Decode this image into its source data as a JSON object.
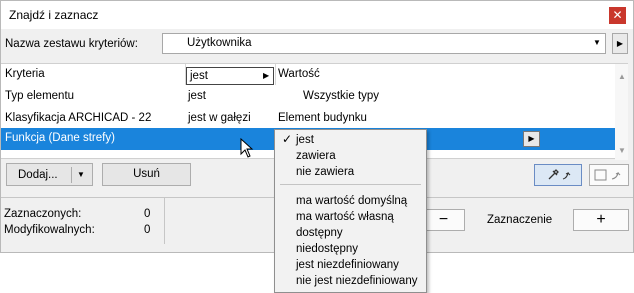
{
  "window": {
    "title": "Znajdź i zaznacz"
  },
  "criteria_set": {
    "label": "Nazwa zestawu kryteriów:",
    "value": "Użytkownika"
  },
  "table": {
    "headers": {
      "criteria": "Kryteria",
      "value": "Wartość"
    },
    "rows": [
      {
        "criterion": "Typ elementu",
        "operator": "jest",
        "value": "Wszystkie typy"
      },
      {
        "criterion": "Klasyfikacja ARCHICAD - 22",
        "operator": "jest w gałęzi",
        "value": "Element budynku"
      },
      {
        "criterion": "Funkcja (Dane strefy)",
        "operator": "jest",
        "value": ""
      }
    ]
  },
  "buttons": {
    "add": "Dodaj...",
    "remove": "Usuń"
  },
  "stats": {
    "selected_label": "Zaznaczonych:",
    "selected_value": "0",
    "editable_label": "Modyfikowalnych:",
    "editable_value": "0"
  },
  "selection": {
    "label": "Zaznaczenie",
    "minus": "−",
    "plus": "+"
  },
  "dropdown": {
    "items_top": [
      "jest",
      "zawiera",
      "nie zawiera"
    ],
    "checked_item": "jest",
    "items_bottom": [
      "ma wartość domyślną",
      "ma wartość własną",
      "dostępny",
      "niedostępny",
      "jest niezdefiniowany",
      "nie jest niezdefiniowany"
    ]
  },
  "colors": {
    "selection": "#1a84dc",
    "close_button": "#c9372c"
  }
}
